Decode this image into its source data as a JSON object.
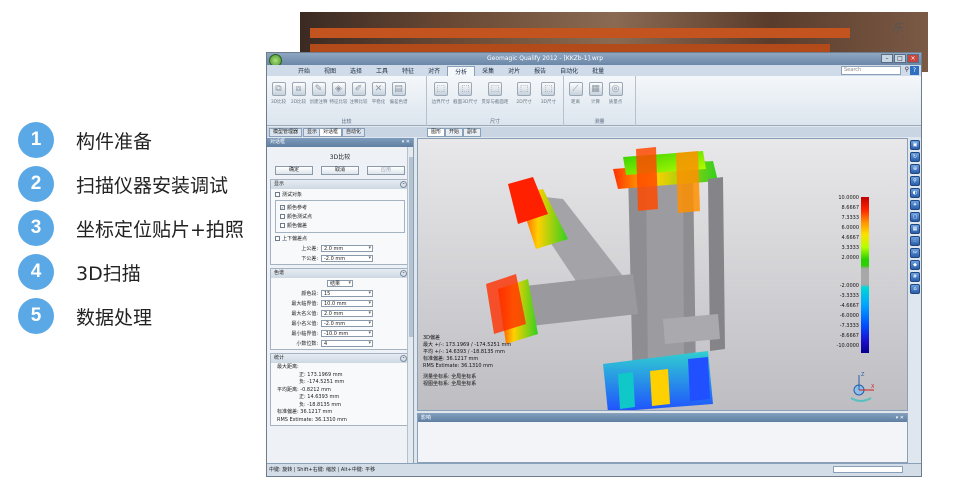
{
  "steps": [
    {
      "num": "1",
      "label": "构件准备"
    },
    {
      "num": "2",
      "label": "扫描仪器安装调试"
    },
    {
      "num": "3",
      "label": "坐标定位贴片+拍照"
    },
    {
      "num": "4",
      "label": "3D扫描"
    },
    {
      "num": "5",
      "label": "数据处理"
    }
  ],
  "signature": "乐",
  "window": {
    "title": "Geomagic Qualify 2012 - [KKZb-1].wrp",
    "minimize": "–",
    "maximize": "□",
    "close": "×"
  },
  "menu": [
    "开始",
    "视图",
    "选择",
    "工具",
    "特征",
    "对齐",
    "分析",
    "采集",
    "对片",
    "报告",
    "自动化",
    "批量"
  ],
  "menu_active_index": 6,
  "search": {
    "placeholder": "Search",
    "help": "?"
  },
  "ribbon": {
    "groups": [
      {
        "label": "比较",
        "buttons": [
          "3D比较",
          "2D比较",
          "创建注释",
          "特征比较",
          "注释比较",
          "平稳化",
          "偏差色谱"
        ]
      },
      {
        "label": "尺寸",
        "buttons": [
          "边界尺寸",
          "截面3D尺寸",
          "贯穿与截面距",
          "2D尺寸",
          "3D尺寸"
        ]
      },
      {
        "label": "测量",
        "buttons": [
          "距离",
          "计算",
          "质量点"
        ]
      }
    ]
  },
  "panel_tabs": [
    "模型管理器",
    "显示",
    "对话框",
    "自动化"
  ],
  "panel_tab_active": 2,
  "view_tabs": [
    "图形",
    "开始",
    "副本"
  ],
  "view_tab_active": 0,
  "dialog": {
    "header": "对话框",
    "title": "3D比较",
    "buttons": {
      "ok": "确定",
      "cancel": "取消",
      "apply": "应用"
    },
    "display": {
      "label": "显示",
      "test_object": "测试对象",
      "color_reference": "颜色参考",
      "color_test": "颜色测试点",
      "color_deviation": "颜色偏差",
      "tolerance": "上下偏差点",
      "upper_label": "上公差:",
      "upper_value": "2.0 mm",
      "lower_label": "下公差:",
      "lower_value": "-2.0 mm"
    },
    "color": {
      "label": "色谱",
      "type": "结果",
      "rows": [
        {
          "label": "颜色段:",
          "value": "15"
        },
        {
          "label": "最大临界值:",
          "value": "10.0 mm"
        },
        {
          "label": "最大名义值:",
          "value": "2.0 mm"
        },
        {
          "label": "最小名义值:",
          "value": "-2.0 mm"
        },
        {
          "label": "最小临界值:",
          "value": "-10.0 mm"
        },
        {
          "label": "小数位数:",
          "value": "4"
        }
      ]
    },
    "stats": {
      "label": "统计",
      "max_dist": "最大距离:",
      "pos": "正: 173.1969 mm",
      "neg": "负: -174.5251 mm",
      "avg": "平均距离: -0.8212 mm",
      "avg_pos": "正: 14.6393 mm",
      "avg_neg": "负: -18.8135 mm",
      "std": "标准偏差: 36.1217 mm",
      "rms": "RMS Estimate: 36.1310 mm"
    }
  },
  "viewport": {
    "info": [
      "3D偏差",
      "最大 +/-: 173.1969 / -174.5251 mm",
      "平均 +/-: 14.6393 / -18.8135 mm",
      "标准偏差: 36.1217 mm",
      "RMS Estimate: 36.1310 mm",
      "",
      "测量坐标系: 全局坐标系",
      "视图坐标系: 全局坐标系"
    ],
    "legend": [
      "10.0000",
      "8.6667",
      "7.3333",
      "6.0000",
      "4.6667",
      "3.3333",
      "2.0000",
      "-2.0000",
      "-3.3333",
      "-4.6667",
      "-6.0000",
      "-7.3333",
      "-8.6667",
      "-10.0000"
    ],
    "axis_z": "Z",
    "axis_x": "X"
  },
  "bottom_pane": {
    "header": "影响"
  },
  "status": "中键: 旋转 | Shift+右键: 缩放 | Alt+中键: 平移"
}
